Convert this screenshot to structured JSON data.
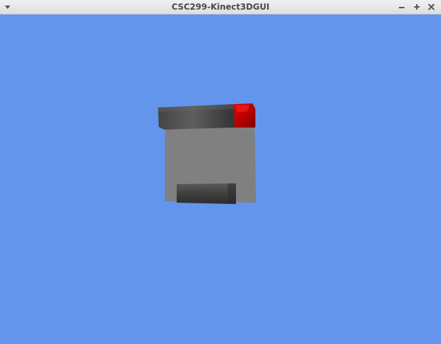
{
  "window": {
    "title": "CSC299-Kinect3DGUI",
    "background_color": "#6495ed"
  },
  "titlebar": {
    "menu_icon": "chevron-down-icon",
    "minimize_icon": "minimize-icon",
    "maximize_icon": "maximize-icon",
    "close_icon": "close-icon"
  },
  "scene": {
    "object": "gray-box-with-tabs",
    "colors": {
      "body": "#808080",
      "tab_dark": "#3c3c3c",
      "tab_red": "#cc0000"
    }
  }
}
